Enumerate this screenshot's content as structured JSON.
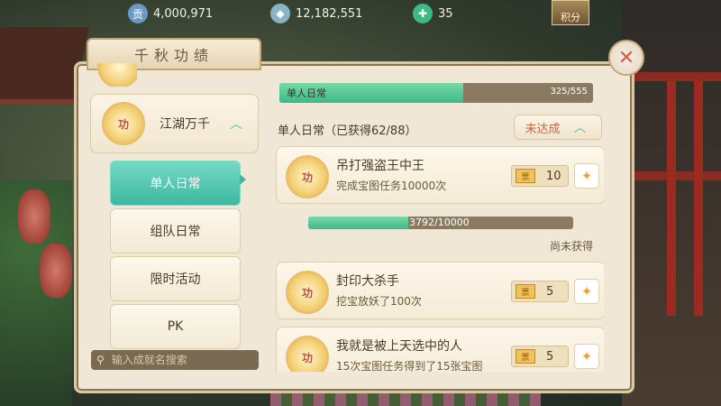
{
  "topbar": {
    "currencies": [
      {
        "icon": "contribution-icon",
        "icon_glyph": "贡",
        "color": "#6a9ac4",
        "value": "4,000,971"
      },
      {
        "icon": "silver-ingot-icon",
        "icon_glyph": "◆",
        "color": "#88b4c4",
        "value": "12,182,551"
      },
      {
        "icon": "jade-coin-icon",
        "icon_glyph": "✚",
        "color": "#3fb888",
        "value": "35"
      }
    ],
    "points_button": "积分"
  },
  "panel": {
    "title": "千秋功绩",
    "close_icon": "close-icon"
  },
  "left": {
    "category": {
      "label": "江湖万千",
      "medal_text": "功"
    },
    "tabs": [
      {
        "label": "单人日常",
        "active": true
      },
      {
        "label": "组队日常",
        "active": false
      },
      {
        "label": "限时活动",
        "active": false
      },
      {
        "label": "PK",
        "active": false
      }
    ],
    "search": {
      "placeholder": "输入成就名搜索"
    }
  },
  "right": {
    "summary": {
      "label": "单人日常",
      "value": "325/555",
      "progress": 0.586
    },
    "subhead": "单人日常（已获得62/88）",
    "status_button": "未达成",
    "achievements": [
      {
        "name": "吊打强盗王中王",
        "desc": "完成宝图任务10000次",
        "reward": "10"
      },
      {
        "name": "封印大杀手",
        "desc": "挖宝放妖了100次",
        "reward": "5"
      },
      {
        "name": "我就是被上天选中的人",
        "desc": "15次宝图任务得到了15张宝图",
        "reward": "5"
      }
    ],
    "progress_row": {
      "value": "3792/10000",
      "progress": 0.379,
      "status": "尚未获得"
    }
  }
}
